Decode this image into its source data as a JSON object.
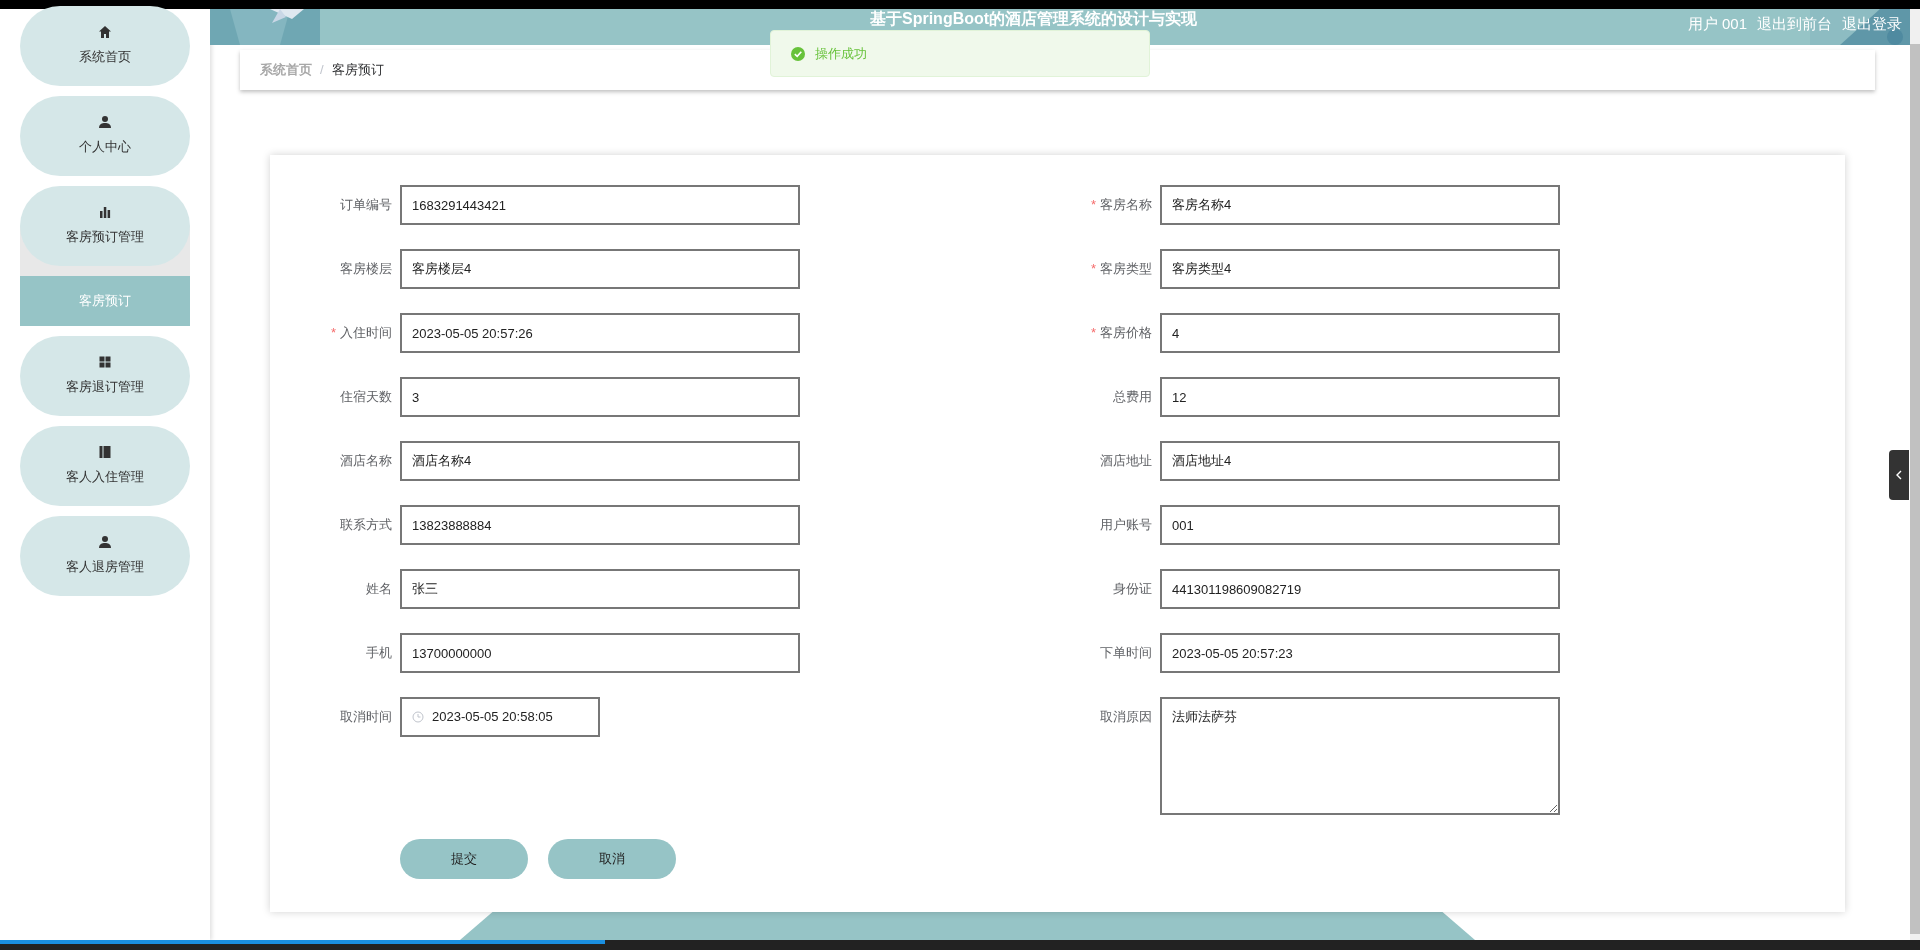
{
  "header": {
    "title": "基于SpringBoot的酒店管理系统的设计与实现",
    "links": [
      "用户 001",
      "退出到前台",
      "退出登录"
    ]
  },
  "toast": {
    "message": "操作成功"
  },
  "sidebar": {
    "items": [
      {
        "label": "系统首页",
        "kind": "home",
        "selected": false
      },
      {
        "label": "个人中心",
        "kind": "user",
        "selected": false
      },
      {
        "label": "客房预订管理",
        "kind": "chart",
        "selected": false,
        "expanded": true,
        "children": [
          {
            "label": "客房预订",
            "selected": true
          }
        ]
      },
      {
        "label": "客房退订管理",
        "kind": "grid",
        "selected": false
      },
      {
        "label": "客人入住管理",
        "kind": "book",
        "selected": false
      },
      {
        "label": "客人退房管理",
        "kind": "user",
        "selected": false
      }
    ]
  },
  "breadcrumb": {
    "items": [
      "系统首页",
      "客房预订"
    ],
    "separator": "/"
  },
  "player": {
    "level": 0.315
  },
  "form": {
    "fields": [
      {
        "label": "订单编号",
        "value": "1683291443421",
        "kind": "input"
      },
      {
        "label": "客房名称",
        "value": "客房名称4",
        "required_mark": "*",
        "kind": "input"
      },
      {
        "label": "客房楼层",
        "value": "客房楼层4",
        "kind": "input"
      },
      {
        "label": "客房类型",
        "value": "客房类型4",
        "required_mark": "*",
        "kind": "input"
      },
      {
        "label": "入住时间",
        "value": "2023-05-05 20:57:26",
        "required_mark": "*",
        "kind": "input"
      },
      {
        "label": "客房价格",
        "value": "4",
        "required_mark": "*",
        "kind": "input"
      },
      {
        "label": "住宿天数",
        "value": "3",
        "kind": "input"
      },
      {
        "label": "总费用",
        "value": "12",
        "kind": "input"
      },
      {
        "label": "酒店名称",
        "value": "酒店名称4",
        "kind": "input"
      },
      {
        "label": "酒店地址",
        "value": "酒店地址4",
        "kind": "input"
      },
      {
        "label": "联系方式",
        "value": "13823888884",
        "kind": "input"
      },
      {
        "label": "用户账号",
        "value": "001",
        "kind": "input"
      },
      {
        "label": "姓名",
        "value": "张三",
        "kind": "input"
      },
      {
        "label": "身份证",
        "value": "441301198609082719",
        "kind": "input"
      },
      {
        "label": "手机",
        "value": "13700000000",
        "kind": "input"
      },
      {
        "label": "下单时间",
        "value": "2023-05-05 20:57:23",
        "kind": "input"
      },
      {
        "label": "取消时间",
        "value": "2023-05-05 20:58:05",
        "kind": "datetime"
      },
      {
        "label": "取消原因",
        "value": "法师法萨芬",
        "kind": "textarea"
      }
    ],
    "buttons": [
      "提交",
      "取消"
    ]
  }
}
